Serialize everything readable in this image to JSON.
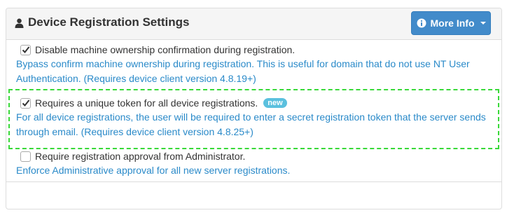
{
  "panel": {
    "title": "Device Registration Settings",
    "more_info_label": "More Info"
  },
  "options": [
    {
      "label": "Disable machine ownership confirmation during registration.",
      "desc_line1": "Bypass confirm machine ownership during registration. This is useful for domain that do not use NT User",
      "desc_line2": "Authentication. (Requires device client version 4.8.19+)",
      "checked": true
    },
    {
      "label": "Requires a unique token for all device registrations.",
      "badge": "new",
      "desc_line1": "For all device registrations, the user will be required to enter a secret registration token that the server sends",
      "desc_line2": "through email. (Requires device client version 4.8.25+)",
      "checked": true
    },
    {
      "label": "Require registration approval from Administrator.",
      "desc_line1": "Enforce Administrative approval for all new server registrations.",
      "checked": false
    }
  ],
  "icons": {
    "title_icon": "user-icon",
    "button_icon": "info-circle-icon",
    "button_caret": "caret-down-icon",
    "check": "checkmark-icon"
  },
  "colors": {
    "button": "#428bca",
    "link_text": "#2a8ac9",
    "badge": "#5bc0de",
    "highlight_border": "#39d939"
  }
}
